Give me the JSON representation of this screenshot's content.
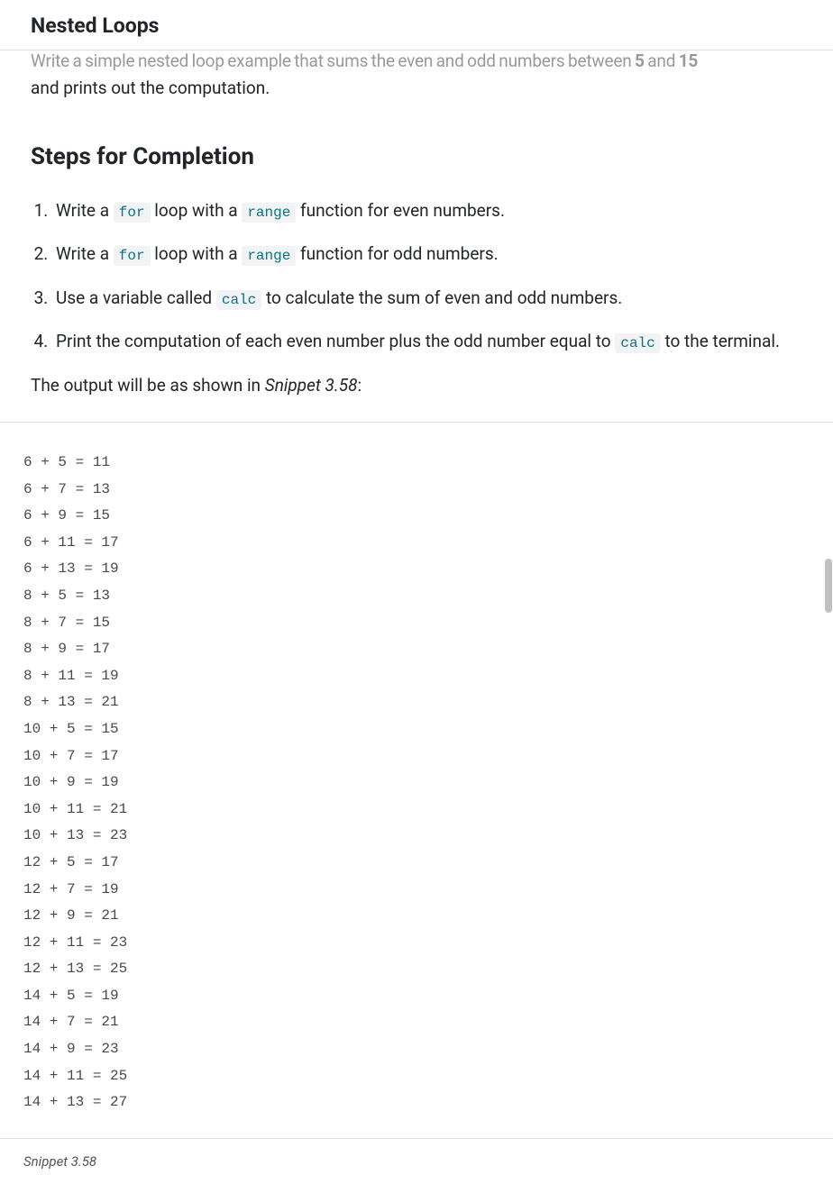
{
  "header": {
    "title": "Nested Loops"
  },
  "intro": {
    "cut_line_prefix": "Write a simple nested loop example that sums the even and odd numbers between ",
    "cut_bold_1": "5",
    "cut_mid": " and ",
    "cut_bold_2": "15",
    "line2": "and prints out the computation."
  },
  "steps_heading": "Steps for Completion",
  "steps": [
    {
      "pre": "Write a ",
      "code1": "for",
      "mid": " loop with a ",
      "code2": "range",
      "post": " function for even numbers."
    },
    {
      "pre": "Write a ",
      "code1": "for",
      "mid": " loop with a ",
      "code2": "range",
      "post": " function for odd numbers."
    },
    {
      "pre": "Use a variable called ",
      "code1": "calc",
      "mid": "",
      "code2": "",
      "post": " to calculate the sum of even and odd numbers."
    },
    {
      "pre": "Print the computation of each even number plus the odd number equal to ",
      "code1": "calc",
      "mid": "",
      "code2": "",
      "post": " to the terminal."
    }
  ],
  "output_intro": {
    "pre": "The output will be as shown in ",
    "em": "Snippet 3.58",
    "post": ":"
  },
  "code_output": "6 + 5 = 11\n6 + 7 = 13\n6 + 9 = 15\n6 + 11 = 17\n6 + 13 = 19\n8 + 5 = 13\n8 + 7 = 15\n8 + 9 = 17\n8 + 11 = 19\n8 + 13 = 21\n10 + 5 = 15\n10 + 7 = 17\n10 + 9 = 19\n10 + 11 = 21\n10 + 13 = 23\n12 + 5 = 17\n12 + 7 = 19\n12 + 9 = 21\n12 + 11 = 23\n12 + 13 = 25\n14 + 5 = 19\n14 + 7 = 21\n14 + 9 = 23\n14 + 11 = 25\n14 + 13 = 27",
  "snippet_label": "Snippet 3.58"
}
